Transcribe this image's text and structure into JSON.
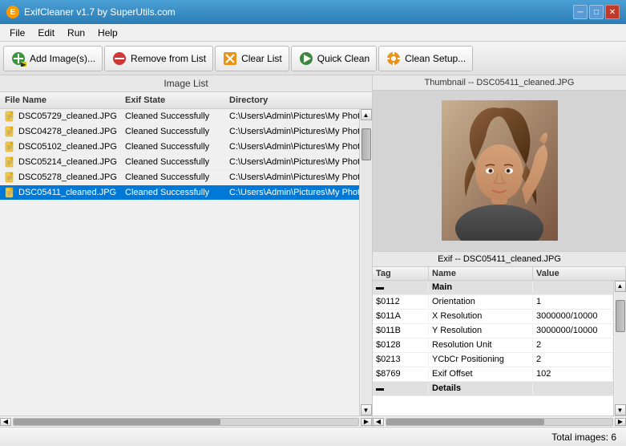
{
  "titleBar": {
    "icon": "E",
    "title": "ExifCleaner v1.7 by SuperUtils.com",
    "minLabel": "─",
    "maxLabel": "□",
    "closeLabel": "✕"
  },
  "menuBar": {
    "items": [
      {
        "label": "File"
      },
      {
        "label": "Edit"
      },
      {
        "label": "Run"
      },
      {
        "label": "Help"
      }
    ]
  },
  "toolbar": {
    "buttons": [
      {
        "id": "add",
        "label": "Add Image(s)...",
        "icon": "➕"
      },
      {
        "id": "remove",
        "label": "Remove from List",
        "icon": "✕"
      },
      {
        "id": "clear",
        "label": "Clear List",
        "icon": "✕"
      },
      {
        "id": "quickclean",
        "label": "Quick Clean",
        "icon": "▶"
      },
      {
        "id": "setup",
        "label": "Clean Setup...",
        "icon": "⚙"
      }
    ]
  },
  "imageList": {
    "header": "Image List",
    "columns": [
      {
        "label": "File Name"
      },
      {
        "label": "Exif State"
      },
      {
        "label": "Directory"
      }
    ],
    "rows": [
      {
        "filename": "DSC05729_cleaned.JPG",
        "exif": "Cleaned Successfully",
        "dir": "C:\\Users\\Admin\\Pictures\\My Photos",
        "selected": false
      },
      {
        "filename": "DSC04278_cleaned.JPG",
        "exif": "Cleaned Successfully",
        "dir": "C:\\Users\\Admin\\Pictures\\My Photos",
        "selected": false
      },
      {
        "filename": "DSC05102_cleaned.JPG",
        "exif": "Cleaned Successfully",
        "dir": "C:\\Users\\Admin\\Pictures\\My Photos",
        "selected": false
      },
      {
        "filename": "DSC05214_cleaned.JPG",
        "exif": "Cleaned Successfully",
        "dir": "C:\\Users\\Admin\\Pictures\\My Photos",
        "selected": false
      },
      {
        "filename": "DSC05278_cleaned.JPG",
        "exif": "Cleaned Successfully",
        "dir": "C:\\Users\\Admin\\Pictures\\My Photos",
        "selected": false
      },
      {
        "filename": "DSC05411_cleaned.JPG",
        "exif": "Cleaned Successfully",
        "dir": "C:\\Users\\Admin\\Pictures\\My Photos",
        "selected": true
      }
    ]
  },
  "thumbnail": {
    "header": "Thumbnail -- DSC05411_cleaned.JPG"
  },
  "exif": {
    "header": "Exif -- DSC05411_cleaned.JPG",
    "columns": [
      {
        "label": "Tag"
      },
      {
        "label": "Name"
      },
      {
        "label": "Value"
      }
    ],
    "groups": [
      {
        "name": "Main",
        "rows": [
          {
            "tag": "$0112",
            "name": "Orientation",
            "value": "1"
          },
          {
            "tag": "$011A",
            "name": "X Resolution",
            "value": "3000000/10000"
          },
          {
            "tag": "$011B",
            "name": "Y Resolution",
            "value": "3000000/10000"
          },
          {
            "tag": "$0128",
            "name": "Resolution Unit",
            "value": "2"
          },
          {
            "tag": "$0213",
            "name": "YCbCr Positioning",
            "value": "2"
          },
          {
            "tag": "$8769",
            "name": "Exif Offset",
            "value": "102"
          }
        ]
      },
      {
        "name": "Details",
        "rows": []
      }
    ]
  },
  "statusBar": {
    "text": "Total images: 6"
  }
}
